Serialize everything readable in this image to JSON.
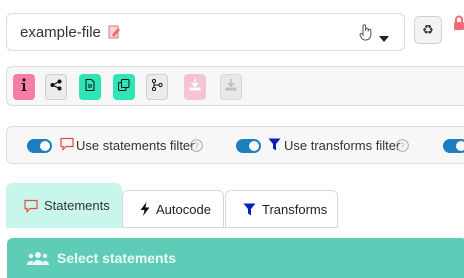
{
  "file": {
    "name": "example-file"
  },
  "filters": {
    "statements_label": "Use statements filter",
    "transforms_label": "Use transforms filter"
  },
  "tabs": [
    {
      "label": "Statements"
    },
    {
      "label": "Autocode"
    },
    {
      "label": "Transforms"
    }
  ],
  "panel": {
    "title": "Select statements"
  },
  "colors": {
    "pink": "#f57ea5",
    "teal": "#2fe4b7",
    "toggle_blue": "#1d7fbf",
    "active_tab": "#c9f6ea",
    "panel": "#5fccb7"
  },
  "icons": [
    "edit-icon",
    "hand-cursor-icon",
    "caret-down-icon",
    "recycle-icon",
    "lock-icon",
    "info-icon",
    "share-icon",
    "document-icon",
    "copy-icon",
    "branch-icon",
    "download-icon",
    "comment-icon",
    "funnel-icon",
    "help-icon",
    "bolt-icon",
    "users-icon"
  ]
}
